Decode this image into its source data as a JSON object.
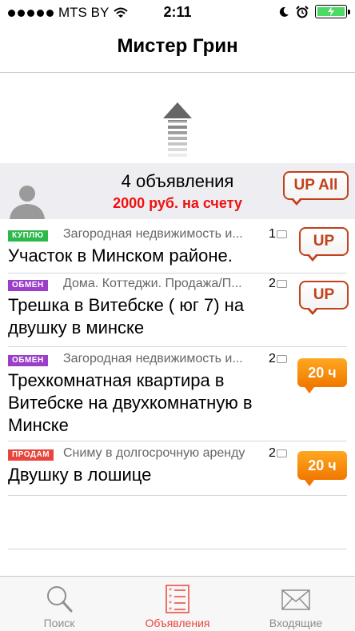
{
  "status_bar": {
    "carrier": "MTS BY",
    "time": "2:11",
    "signal_icon": "signal-dots-icon",
    "wifi_icon": "wifi-icon",
    "moon_icon": "moon-icon",
    "alarm_icon": "alarm-icon",
    "battery_icon": "battery-icon",
    "battery_color": "#4cd964"
  },
  "header": {
    "title": "Мистер Грин"
  },
  "pull_refresh_icon": "arrow-up-icon",
  "account": {
    "count_text": "4 объявления",
    "balance_text": "2000 руб. на счету",
    "up_all_label": "UP All",
    "avatar_icon": "avatar-placeholder-icon"
  },
  "listings": [
    {
      "tag": "КУПЛЮ",
      "tag_color": "#2db84b",
      "category": "Загородная недвижимость и...",
      "count": "1",
      "title": "Участок в Минском районе.",
      "badge": "UP",
      "badge_type": "up"
    },
    {
      "tag": "ОБМЕН",
      "tag_color": "#9b3fc9",
      "category": "Дома. Коттеджи. Продажа/П...",
      "count": "2",
      "title": "Трешка в Витебске ( юг 7) на двушку в минске",
      "badge": "UP",
      "badge_type": "up"
    },
    {
      "tag": "ОБМЕН",
      "tag_color": "#9b3fc9",
      "category": "Загородная недвижимость и...",
      "count": "2",
      "title": "Трехкомнатная квартира в Витебске на двухкомнатную в Минске",
      "badge": "20 ч",
      "badge_type": "time"
    },
    {
      "tag": "ПРОДАМ",
      "tag_color": "#e8453c",
      "category": "Сниму в долгосрочную аренду",
      "count": "2",
      "title": "Двушку в лошице",
      "badge": "20 ч",
      "badge_type": "time"
    }
  ],
  "tabbar": {
    "active_color": "#e8453c",
    "tabs": [
      {
        "label": "Поиск",
        "icon": "search-icon"
      },
      {
        "label": "Объявления",
        "icon": "list-icon"
      },
      {
        "label": "Входящие",
        "icon": "envelope-icon"
      }
    ]
  }
}
